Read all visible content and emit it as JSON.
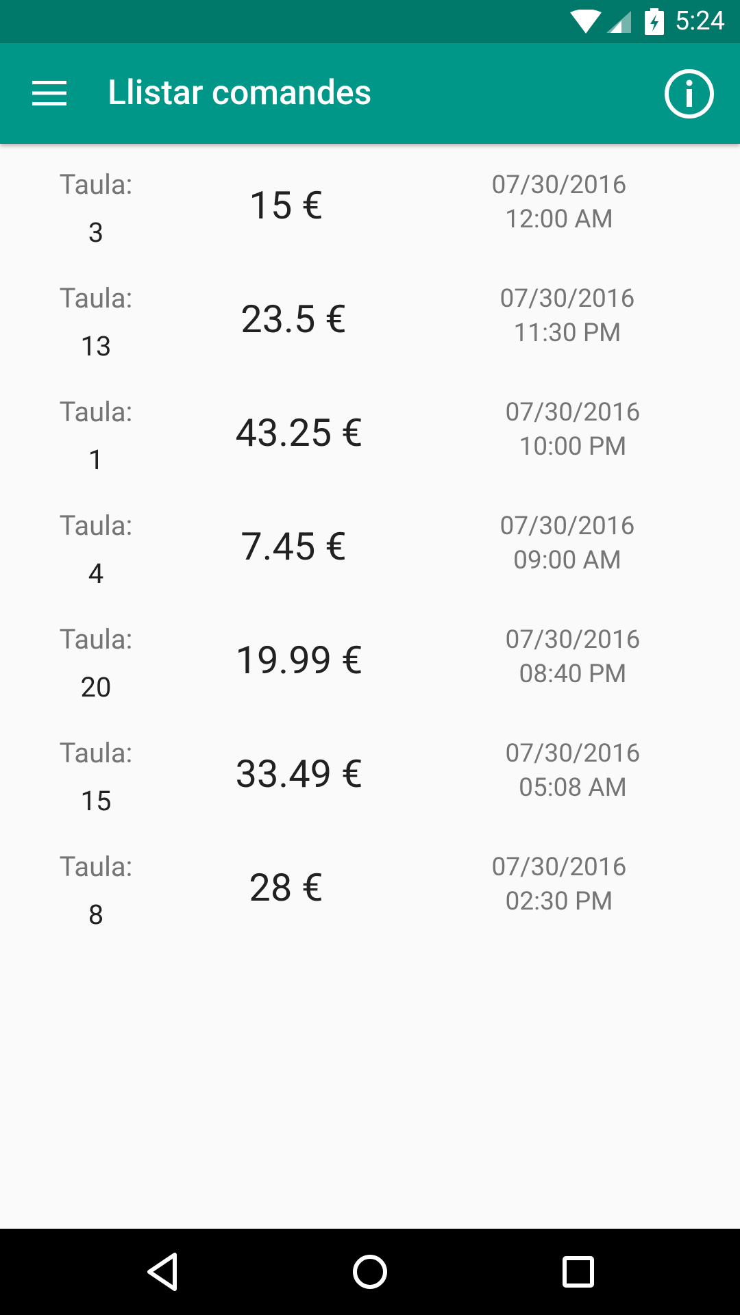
{
  "status_bar": {
    "time": "5:24",
    "icons": [
      "wifi-icon",
      "cellular-signal-icon",
      "battery-charging-icon"
    ]
  },
  "app_bar": {
    "title": "Llistar comandes",
    "left_icon": "menu-icon",
    "right_icon": "info-icon"
  },
  "colors": {
    "status_bar": "#00796b",
    "app_bar": "#009688",
    "background": "#fafafa",
    "primary_text": "#212121",
    "secondary_text": "#757575",
    "nav_bar": "#000000"
  },
  "orders": [
    {
      "table_label": "Taula:",
      "table_number": "3",
      "total": "15 €",
      "date": "07/30/2016",
      "time": "12:00 AM"
    },
    {
      "table_label": "Taula:",
      "table_number": "13",
      "total": "23.5 €",
      "date": "07/30/2016",
      "time": "11:30 PM"
    },
    {
      "table_label": "Taula:",
      "table_number": "1",
      "total": "43.25 €",
      "date": "07/30/2016",
      "time": "10:00 PM"
    },
    {
      "table_label": "Taula:",
      "table_number": "4",
      "total": "7.45 €",
      "date": "07/30/2016",
      "time": "09:00 AM"
    },
    {
      "table_label": "Taula:",
      "table_number": "20",
      "total": "19.99 €",
      "date": "07/30/2016",
      "time": "08:40 PM"
    },
    {
      "table_label": "Taula:",
      "table_number": "15",
      "total": "33.49 €",
      "date": "07/30/2016",
      "time": "05:08 AM"
    },
    {
      "table_label": "Taula:",
      "table_number": "8",
      "total": "28 €",
      "date": "07/30/2016",
      "time": "02:30 PM"
    }
  ],
  "nav_bar": {
    "buttons": [
      "back-icon",
      "home-icon",
      "recents-icon"
    ]
  }
}
